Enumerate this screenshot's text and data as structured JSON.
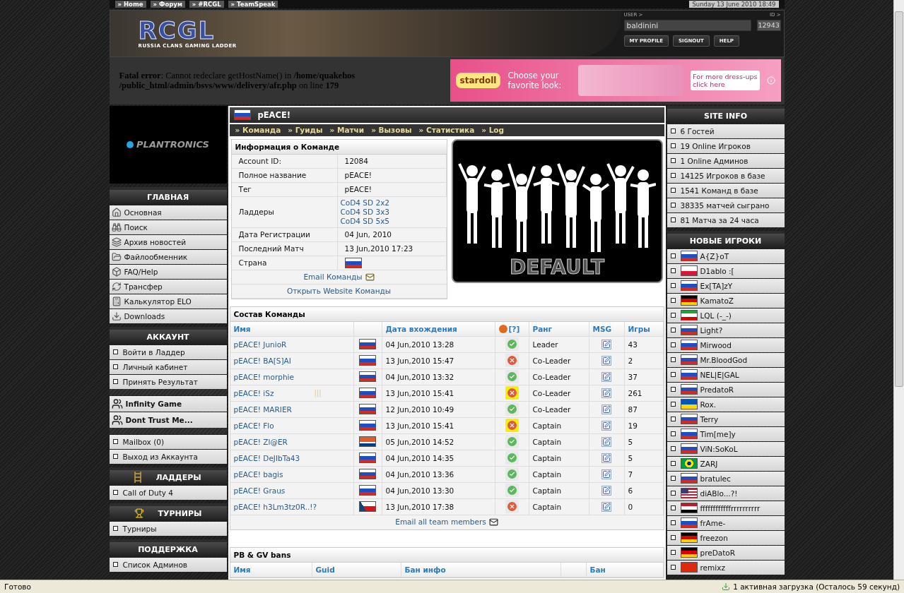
{
  "top_nav": {
    "links": [
      "» Home",
      "» Форум",
      "» #RCGL",
      "» TeamSpeak"
    ],
    "datetime": "Sunday 13 June 2010 18:49"
  },
  "header": {
    "logo": "RCGL",
    "tagline": "RUSSIA CLANS GAMING LADDER",
    "user_label": "USER >",
    "id_label": "ID >",
    "username": "baldinini",
    "user_id": "12943",
    "buttons": [
      "MY PROFILE",
      "SIGNOUT",
      "HELP"
    ]
  },
  "error": "**Fatal error**: Cannot redeclare getHostName() in **/home/quakehos /public_html/admin/bsvs/www/delivery/afr.php** on line **179**",
  "ad_top": {
    "brand": "stardoll",
    "headline": "Choose your favorite look:",
    "cta": "For more dress-ups click here"
  },
  "ad_left": {
    "brand": "PLANTRONICS"
  },
  "left_sections": [
    {
      "title": "ГЛАВНАЯ",
      "kind": "icons",
      "items": [
        "Основная",
        "Поиск",
        "Архив новостей",
        "Файлообменник",
        "FAQ/Help",
        "Трансфер",
        "Калькулятор ELO",
        "Downloads"
      ]
    },
    {
      "title": "АККАУНТ",
      "kind": "bullets",
      "items": [
        "Войти в Ладдер",
        "Личный кабинет",
        "Принять Результат"
      ]
    },
    {
      "kind": "teams",
      "items": [
        "Infinity Game",
        "Dont Trust Me..."
      ]
    },
    {
      "kind": "bullets",
      "items": [
        "Mailbox (0)",
        "Выход из Аккаунта"
      ]
    },
    {
      "title": "ЛАДДЕРЫ",
      "kind": "bullets",
      "items": [
        "Call of Duty 4"
      ]
    },
    {
      "title": "ТУРНИРЫ",
      "kind": "bullets",
      "items": [
        "Турниры"
      ]
    },
    {
      "title": "ПОДДЕРЖКА",
      "kind": "bullets",
      "items": [
        "Список Админов"
      ]
    }
  ],
  "team": {
    "name": "pEACE!",
    "flag": {
      "kind": "ru"
    },
    "tabs": [
      "» Команда",
      "» Гуиды",
      "» Матчи",
      "» Вызовы",
      "» Статистика",
      "» Log"
    ],
    "info_title": "Информация о Команде",
    "info": [
      {
        "label": "Account ID:",
        "kind": "text",
        "value": "12084"
      },
      {
        "label": "Полное название",
        "kind": "text",
        "value": "pEACE!"
      },
      {
        "label": "Тег",
        "kind": "text",
        "value": "pEACE!"
      },
      {
        "label": "Ладдеры",
        "kind": "links",
        "values": [
          "CoD4 SD 2x2",
          "CoD4 SD 3x3",
          "CoD4 SD 5x5"
        ]
      },
      {
        "label": "Дата Регистрации",
        "kind": "text",
        "value": "04 Jun, 2010"
      },
      {
        "label": "Последний Матч",
        "kind": "text",
        "value": "13 Jun,2010 17:23"
      },
      {
        "label": "Страна",
        "kind": "flag",
        "flag": {
          "kind": "ru"
        }
      }
    ],
    "email_link": "Email Команды",
    "website_link": "Открыть Website Команды",
    "logo_caption": "DEFAULT"
  },
  "roster": {
    "title": "Состав Команды",
    "columns": {
      "name": "Имя",
      "joined": "Дата вхождения",
      "help": "[?]",
      "rank": "Ранг",
      "msg": "MSG",
      "games": "Игры"
    },
    "rows": [
      {
        "name": "pEACE! JunioR",
        "flag": {
          "kind": "ru"
        },
        "joined": "04 Jun,2010 13:28",
        "status": {
          "kind": "ok"
        },
        "highlighted": false,
        "rank": "Leader",
        "games": "43"
      },
      {
        "name": "pEACE! BA[S]AI",
        "flag": {
          "kind": "ru"
        },
        "joined": "13 Jun,2010 15:47",
        "status": {
          "kind": "banned"
        },
        "highlighted": false,
        "rank": "Co-Leader",
        "games": "2"
      },
      {
        "name": "pEACE! morphie",
        "flag": {
          "kind": "ru"
        },
        "joined": "04 Jun,2010 13:32",
        "status": {
          "kind": "ok"
        },
        "highlighted": false,
        "rank": "Co-Leader",
        "games": "37"
      },
      {
        "name": "pEACE! iSz",
        "note": "|||",
        "flag": {
          "kind": "ru"
        },
        "joined": "13 Jun,2010 15:41",
        "status": {
          "kind": "banned"
        },
        "highlighted": true,
        "rank": "Co-Leader",
        "games": "261"
      },
      {
        "name": "pEACE! MARIER",
        "flag": {
          "kind": "ru"
        },
        "joined": "12 Jun,2010 10:49",
        "status": {
          "kind": "ok"
        },
        "highlighted": false,
        "rank": "Co-Leader",
        "games": "87"
      },
      {
        "name": "pEACE! Flo",
        "flag": {
          "kind": "ru"
        },
        "joined": "13 Jun,2010 15:41",
        "status": {
          "kind": "banned"
        },
        "highlighted": true,
        "rank": "Captain",
        "games": "19"
      },
      {
        "name": "pEACE! Zl@ER",
        "flag": {
          "kind": "ki"
        },
        "joined": "05 Jun,2010 14:52",
        "status": {
          "kind": "ok"
        },
        "highlighted": false,
        "rank": "Captain",
        "games": "5"
      },
      {
        "name": "pEACE! DeJIbTa43",
        "flag": {
          "kind": "ru"
        },
        "joined": "04 Jun,2010 14:35",
        "status": {
          "kind": "ok"
        },
        "highlighted": false,
        "rank": "Captain",
        "games": "5"
      },
      {
        "name": "pEACE! bagis",
        "flag": {
          "kind": "ru"
        },
        "joined": "04 Jun,2010 13:36",
        "status": {
          "kind": "ok"
        },
        "highlighted": false,
        "rank": "Captain",
        "games": "7"
      },
      {
        "name": "pEACE! Graus",
        "flag": {
          "kind": "ru"
        },
        "joined": "04 Jun,2010 13:30",
        "status": {
          "kind": "ok"
        },
        "highlighted": false,
        "rank": "Captain",
        "games": "6"
      },
      {
        "name": "pEACE! h3Lm3tz0R..!?",
        "flag": {
          "kind": "cz"
        },
        "joined": "13 Jun,2010 17:38",
        "status": {
          "kind": "banned"
        },
        "highlighted": false,
        "rank": "Captain",
        "games": "0"
      }
    ],
    "email_all": "Email all team members"
  },
  "bans": {
    "title": "PB & GV bans",
    "columns": [
      "Имя",
      "Guid",
      "Бан инфо",
      "",
      "Бан"
    ]
  },
  "site_info": {
    "title": "SITE INFO",
    "items": [
      "6 Гостей",
      "19 Online Игроков",
      "1 Online Админов",
      "14125 Игроков в базе",
      "1541 Команд в базе",
      "38335 матчей сыграно",
      "81 Матча за 24 часа"
    ]
  },
  "new_players": {
    "title": "НОВЫЕ ИГРОКИ",
    "items": [
      {
        "name": "A{Z}oT",
        "flag": {
          "kind": "ru"
        }
      },
      {
        "name": "D1ablo :[",
        "flag": {
          "kind": "pl"
        }
      },
      {
        "name": "Ex[TA]zY",
        "flag": {
          "kind": "ru"
        }
      },
      {
        "name": "KamatoZ",
        "flag": {
          "kind": "de"
        }
      },
      {
        "name": "LQL (-_-)",
        "flag": {
          "kind": "ir"
        }
      },
      {
        "name": "Light?",
        "flag": {
          "kind": "ru"
        }
      },
      {
        "name": "Mirwood",
        "flag": {
          "kind": "ru"
        }
      },
      {
        "name": "Mr.BloodGod",
        "flag": {
          "kind": "ru"
        }
      },
      {
        "name": "NEL|E|GAL",
        "flag": {
          "kind": "ru"
        }
      },
      {
        "name": "PredatoR",
        "flag": {
          "kind": "ru"
        }
      },
      {
        "name": "Rox.",
        "flag": {
          "kind": "ua"
        }
      },
      {
        "name": "Terry",
        "flag": {
          "kind": "ru"
        }
      },
      {
        "name": "Tim[me]y",
        "flag": {
          "kind": "ru"
        }
      },
      {
        "name": "ViN:SoKoL",
        "flag": {
          "kind": "ru"
        }
      },
      {
        "name": "ZARJ",
        "flag": {
          "kind": "br"
        }
      },
      {
        "name": "bratulec",
        "flag": {
          "kind": "ru"
        }
      },
      {
        "name": "diABlo...?!",
        "flag": {
          "kind": "us"
        }
      },
      {
        "name": "ffffffffffffrrrrrrrrrr",
        "flag": {
          "kind": "eg"
        }
      },
      {
        "name": "frAme-",
        "flag": {
          "kind": "ru"
        }
      },
      {
        "name": "freezon",
        "flag": {
          "kind": "de"
        }
      },
      {
        "name": "preDatoR",
        "flag": {
          "kind": "de"
        }
      },
      {
        "name": "remixz",
        "flag": {
          "kind": "cn"
        }
      }
    ]
  },
  "status_bar": {
    "text": "Готово",
    "downloads": "1 активная загрузка (Осталось 59 секунд)"
  }
}
